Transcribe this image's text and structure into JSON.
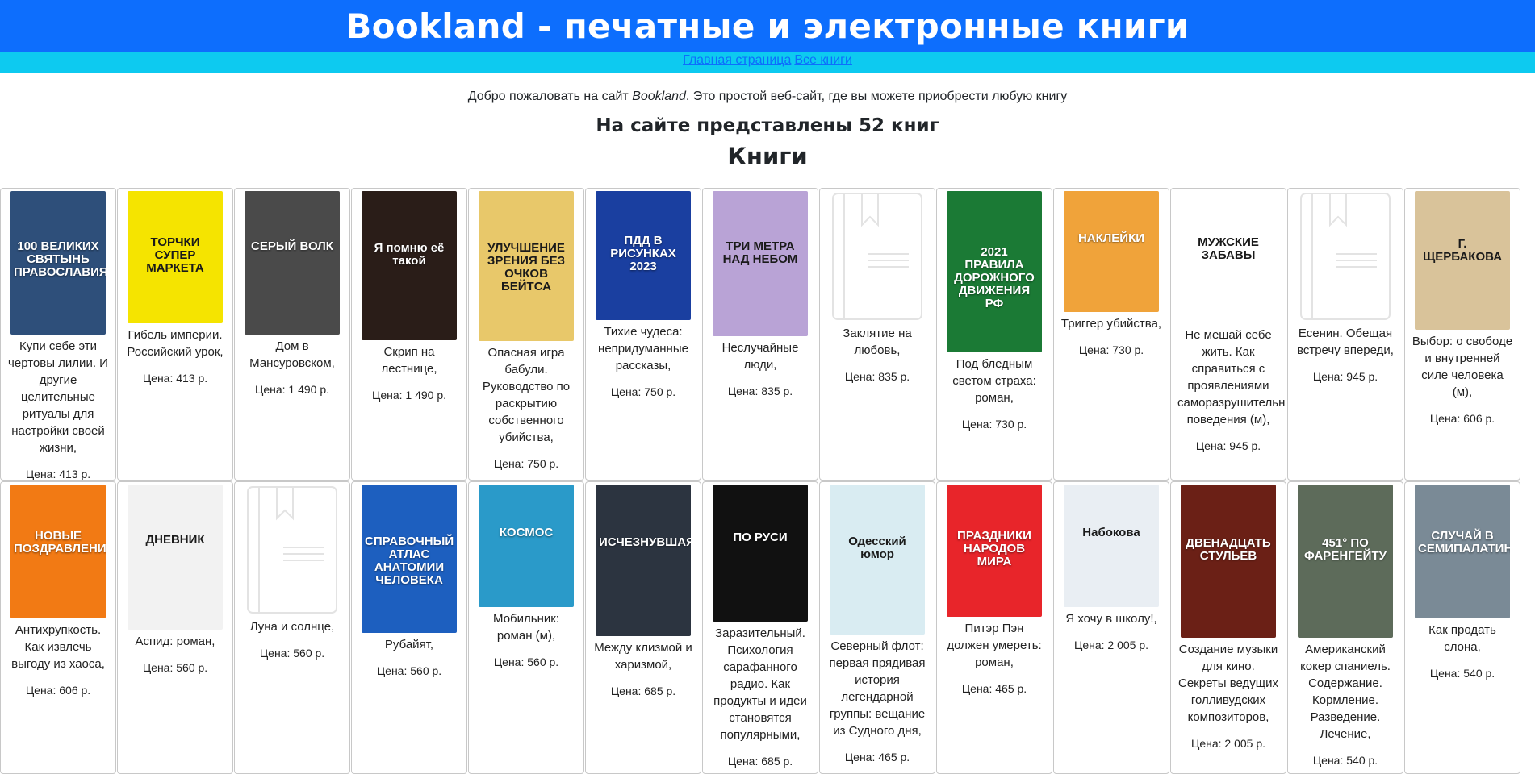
{
  "header": {
    "title": "Bookland - печатные и электронные книги"
  },
  "nav": {
    "links": [
      "Главная страница",
      "Все книги"
    ]
  },
  "welcome": {
    "before": "Добро пожаловать на сайт ",
    "site": "Bookland",
    "after": ". Это простой веб-сайт, где вы можете приобрести любую книгу"
  },
  "count_text": "На сайте представлены 52 книг",
  "section_title": "Книги",
  "books": [
    {
      "title": "Купи себе эти чертовы лилии. И другие целительные ритуалы для настройки своей жизни,",
      "price": "Цена: 413 р.",
      "cover_text": "100 ВЕЛИКИХ СВЯТЫНЬ ПРАВОСЛАВИЯ",
      "cover_color": "#2e4f7a",
      "cover_h": 178
    },
    {
      "title": "Гибель империи. Российский урок,",
      "price": "Цена: 413 р.",
      "cover_text": "ТОРЧКИ СУПЕР МАРКЕТА",
      "cover_color": "#f5e400",
      "cover_h": 164
    },
    {
      "title": "Дом в Мансуровском,",
      "price": "Цена: 1 490 р.",
      "cover_text": "СЕРЫЙ ВОЛК",
      "cover_color": "#4a4a4a",
      "cover_h": 178
    },
    {
      "title": "Скрип на лестнице,",
      "price": "Цена: 1 490 р.",
      "cover_text": "Я помню её такой",
      "cover_color": "#2a1d18",
      "cover_h": 185
    },
    {
      "title": "Опасная игра бабули. Руководство по раскрытию собственного убийства,",
      "price": "Цена: 750 р.",
      "cover_text": "УЛУЧШЕНИЕ ЗРЕНИЯ БЕЗ ОЧКОВ БЕЙТСА",
      "cover_color": "#e8c86a",
      "cover_h": 186
    },
    {
      "title": "Тихие чудеса: непридуманные рассказы,",
      "price": "Цена: 750 р.",
      "cover_text": "ПДД В РИСУНКАХ 2023",
      "cover_color": "#1a3fa0",
      "cover_h": 160
    },
    {
      "title": "Неслучайные люди,",
      "price": "Цена: 835 р.",
      "cover_text": "ТРИ МЕТРА НАД НЕБОМ",
      "cover_color": "#b9a3d6",
      "cover_h": 180
    },
    {
      "title": "Заклятие на любовь,",
      "price": "Цена: 835 р.",
      "cover_text": "",
      "cover_color": "",
      "cover_h": 162
    },
    {
      "title": "Под бледным светом страха: роман,",
      "price": "Цена: 730 р.",
      "cover_text": "2021 ПРАВИЛА ДОРОЖНОГО ДВИЖЕНИЯ РФ",
      "cover_color": "#1b7a35",
      "cover_h": 200
    },
    {
      "title": "Триггер убийства,",
      "price": "Цена: 730 р.",
      "cover_text": "НАКЛЕЙКИ",
      "cover_color": "#f0a33a",
      "cover_h": 150
    },
    {
      "title": "Не мешай себе жить. Как справиться с проявлениями саморазрушительного поведения (м),",
      "price": "Цена: 945 р.",
      "cover_text": "МУЖСКИЕ ЗАБАВЫ",
      "cover_color": "#ffffff",
      "cover_h": 164
    },
    {
      "title": "Есенин. Обещая встречу впереди,",
      "price": "Цена: 945 р.",
      "cover_text": "",
      "cover_color": "",
      "cover_h": 162
    },
    {
      "title": "Выбор: о свободе и внутренней силе человека (м),",
      "price": "Цена: 606 р.",
      "cover_text": "Г. ЩЕРБАКОВА",
      "cover_color": "#d9c39a",
      "cover_h": 172
    },
    {
      "title": "Антихрупкость. Как извлечь выгоду из хаоса,",
      "price": "Цена: 606 р.",
      "cover_text": "НОВЫЕ ПОЗДРАВЛЕНИЯ",
      "cover_color": "#f27a14",
      "cover_h": 166
    },
    {
      "title": "Аспид: роман,",
      "price": "Цена: 560 р.",
      "cover_text": "ДНЕВНИК",
      "cover_color": "#f2f2f2",
      "cover_h": 180
    },
    {
      "title": "Луна и солнце,",
      "price": "Цена: 560 р.",
      "cover_text": "",
      "cover_color": "",
      "cover_h": 162
    },
    {
      "title": "Рубайят,",
      "price": "Цена: 560 р.",
      "cover_text": "СПРАВОЧНЫЙ АТЛАС АНАТОМИИ ЧЕЛОВЕКА",
      "cover_color": "#1d5fbf",
      "cover_h": 184
    },
    {
      "title": "Мобильник: роман (м),",
      "price": "Цена: 560 р.",
      "cover_text": "КОСМОС",
      "cover_color": "#2a9ac9",
      "cover_h": 152
    },
    {
      "title": "Между клизмой и харизмой,",
      "price": "Цена: 685 р.",
      "cover_text": "ИСЧЕЗНУВШАЯ",
      "cover_color": "#2c3440",
      "cover_h": 188
    },
    {
      "title": "Заразительный. Психология сарафанного радио. Как продукты и идеи становятся популярными,",
      "price": "Цена: 685 р.",
      "cover_text": "ПО РУСИ",
      "cover_color": "#111111",
      "cover_h": 170
    },
    {
      "title": "Северный флот: первая прядивая история легендарной группы: вещание из Судного дня,",
      "price": "Цена: 465 р.",
      "cover_text": "Одесский юмор",
      "cover_color": "#d9ecf2",
      "cover_h": 186
    },
    {
      "title": "Питэр Пэн должен умереть: роман,",
      "price": "Цена: 465 р.",
      "cover_text": "ПРАЗДНИКИ НАРОДОВ МИРА",
      "cover_color": "#e8252a",
      "cover_h": 164
    },
    {
      "title": "Я хочу в школу!,",
      "price": "Цена: 2 005 р.",
      "cover_text": "Набокова",
      "cover_color": "#e9eef3",
      "cover_h": 152
    },
    {
      "title": "Создание музыки для кино. Секреты ведущих голливудских композиторов,",
      "price": "Цена: 2 005 р.",
      "cover_text": "ДВЕНАДЦАТЬ СТУЛЬЕВ",
      "cover_color": "#6b2016",
      "cover_h": 190
    },
    {
      "title": "Американский кокер спаниель. Содержание. Кормление. Разведение. Лечение,",
      "price": "Цена: 540 р.",
      "cover_text": "451° ПО ФАРЕНГЕЙТУ",
      "cover_color": "#5d6b5a",
      "cover_h": 190
    },
    {
      "title": "Как продать слона,",
      "price": "Цена: 540 р.",
      "cover_text": "СЛУЧАЙ В СЕМИПАЛАТИНСКЕ",
      "cover_color": "#7a8a96",
      "cover_h": 166
    }
  ]
}
